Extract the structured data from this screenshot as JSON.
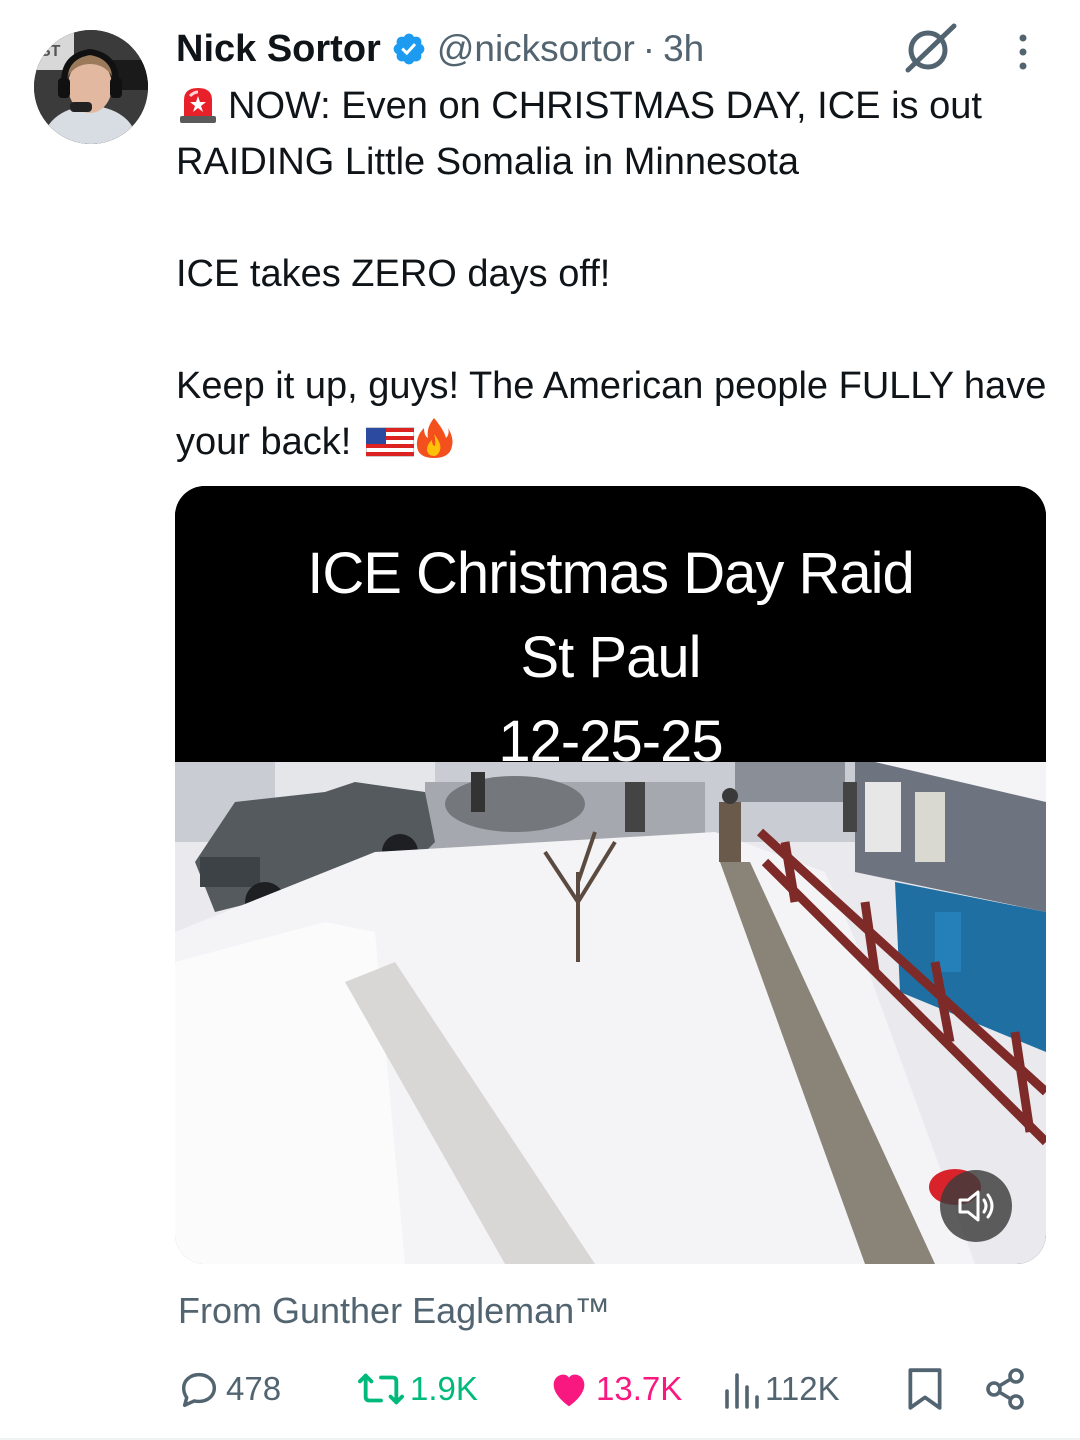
{
  "author": {
    "name": "Nick Sortor",
    "handle": "@nicksortor",
    "separator": "·",
    "time": "3h",
    "verified_color": "#1d9bf0"
  },
  "tweet": {
    "line1": "NOW: Even on CHRISTMAS DAY, ICE is out RAIDING Little Somalia in Minnesota",
    "line2": "ICE takes ZERO days off!",
    "line3": "Keep it up, guys! The American people FULLY have your back!",
    "emojis": [
      "siren-emoji",
      "us-flag-emoji",
      "fire-emoji"
    ]
  },
  "media": {
    "caption": [
      "ICE Christmas Day Raid",
      "St Paul",
      "12-25-25"
    ],
    "sound_icon": "speaker-icon"
  },
  "source": "From Gunther Eagleman™",
  "actions": {
    "replies": "478",
    "reposts": "1.9K",
    "likes": "13.7K",
    "views": "112K"
  },
  "colors": {
    "text": "#0f1419",
    "secondary": "#536471",
    "repost": "#00ba7c",
    "like": "#f91880"
  }
}
